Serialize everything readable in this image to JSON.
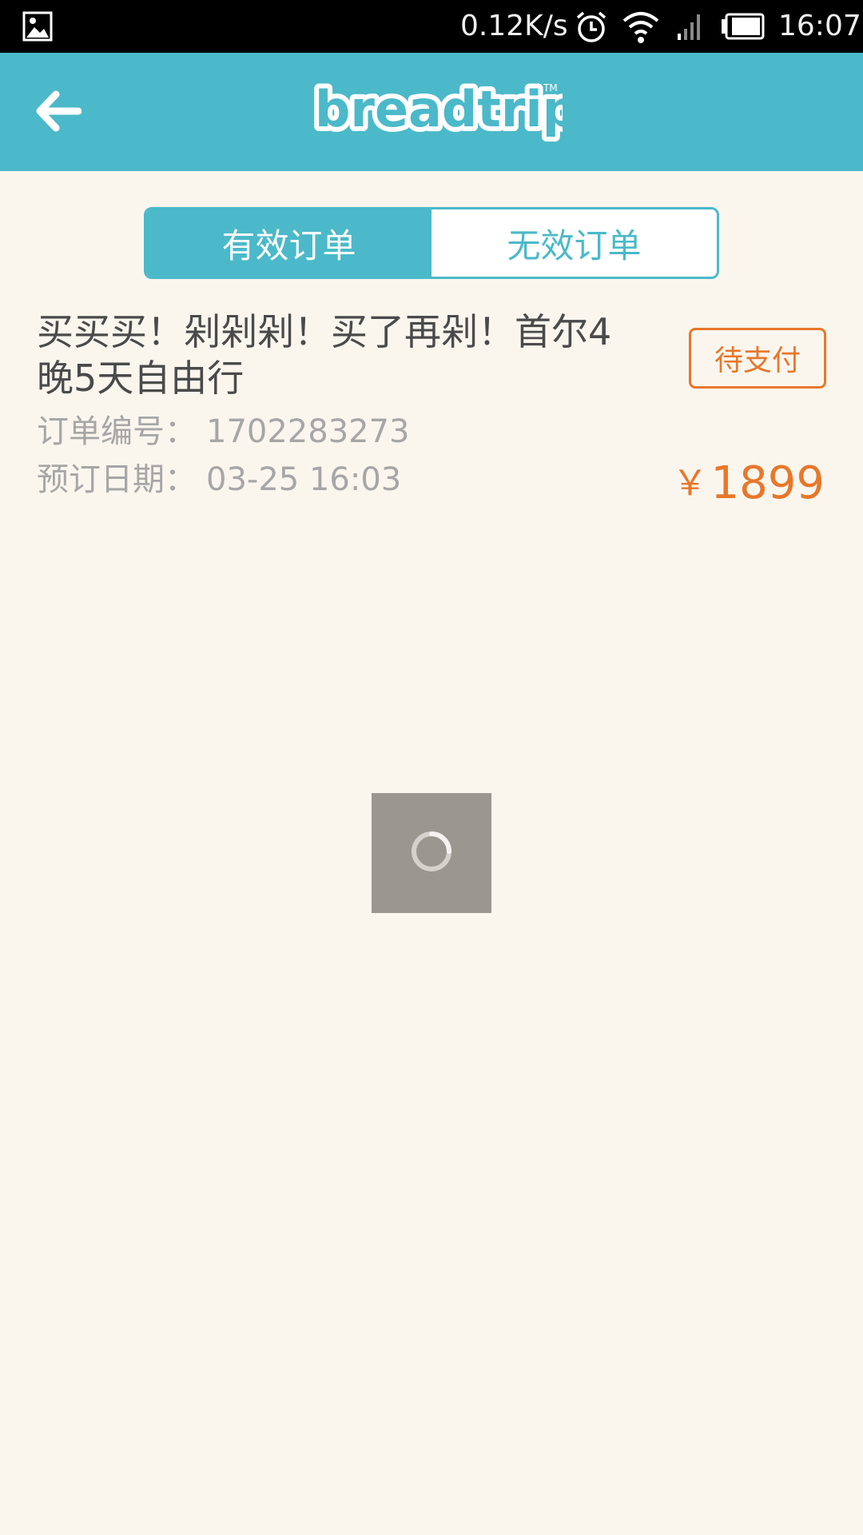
{
  "status_bar": {
    "net_speed": "0.12K/s",
    "time": "16:07",
    "icons": [
      "gallery-icon",
      "alarm-icon",
      "wifi-icon",
      "signal-icon",
      "battery-icon"
    ]
  },
  "app_bar": {
    "back_icon": "back-arrow-icon",
    "logo_text": "breadtrip",
    "logo_tm": "TM"
  },
  "tabs": [
    {
      "label": "有效订单",
      "active": true
    },
    {
      "label": "无效订单",
      "active": false
    }
  ],
  "order": {
    "title": "买买买！剁剁剁！买了再剁！首尔4晚5天自由行",
    "status": "待支付",
    "order_no_label": "订单编号：",
    "order_no": "1702283273",
    "date_label": "预订日期：",
    "date": "03-25 16:03",
    "currency": "￥",
    "price": "1899"
  },
  "loading": {
    "icon": "spinner-icon"
  },
  "colors": {
    "accent": "#4bb9c9",
    "orange": "#e8772a",
    "background": "#faf6ee",
    "loading_bg": "#9a9790"
  }
}
